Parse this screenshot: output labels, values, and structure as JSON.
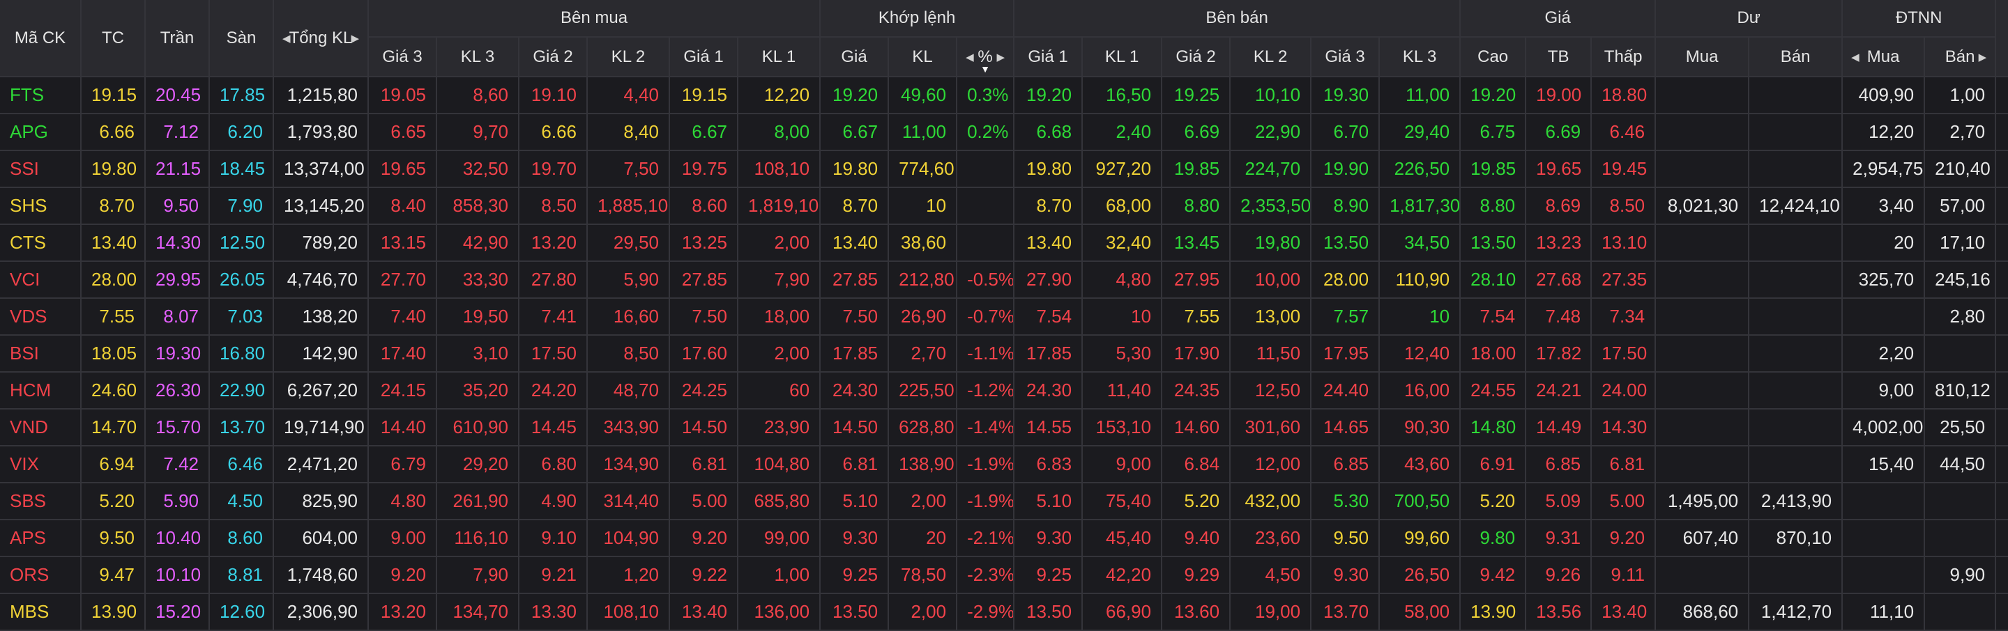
{
  "colors": {
    "up": "#2ed937",
    "down": "#f2424a",
    "ref": "#f0d236",
    "ceil": "#e45fff",
    "floor": "#38d4e8",
    "neutral": "#e8e8e8"
  },
  "icons": {
    "sort_left": "caret-left-icon",
    "sort_right": "caret-right-icon",
    "sort_down": "caret-down-icon"
  },
  "header": {
    "ma_ck": "Mã CK",
    "tc": "TC",
    "tran": "Trần",
    "san": "Sàn",
    "tong_kl": "Tổng KL",
    "ben_mua": "Bên mua",
    "khop_lenh": "Khớp lệnh",
    "ben_ban": "Bên bán",
    "gia": "Giá",
    "du": "Dư",
    "dtnn": "ĐTNN",
    "sub": {
      "gia3": "Giá 3",
      "kl3": "KL 3",
      "gia2": "Giá 2",
      "kl2": "KL 2",
      "gia1": "Giá 1",
      "kl1": "KL 1",
      "khop_gia": "Giá",
      "khop_kl": "KL",
      "pct": "%",
      "ban_gia1": "Giá 1",
      "ban_kl1": "KL 1",
      "ban_gia2": "Giá 2",
      "ban_kl2": "KL 2",
      "ban_gia3": "Giá 3",
      "ban_kl3": "KL 3",
      "cao": "Cao",
      "tb": "TB",
      "thap": "Thấp",
      "du_mua": "Mua",
      "du_ban": "Bán",
      "nn_mua": "Mua",
      "nn_ban": "Bán"
    }
  },
  "rows": [
    [
      "FTS",
      "19.15",
      "20.45",
      "17.85",
      "1,215,80",
      "19.05",
      "8,60",
      "19.10",
      "4,40",
      "19.15",
      "12,20",
      "19.20",
      "49,60",
      "0.3%",
      "19.20",
      "16,50",
      "19.25",
      "10,10",
      "19.30",
      "11,00",
      "19.20",
      "19.00",
      "18.80",
      "",
      "",
      "409,90",
      "1,00"
    ],
    [
      "APG",
      "6.66",
      "7.12",
      "6.20",
      "1,793,80",
      "6.65",
      "9,70",
      "6.66",
      "8,40",
      "6.67",
      "8,00",
      "6.67",
      "11,00",
      "0.2%",
      "6.68",
      "2,40",
      "6.69",
      "22,90",
      "6.70",
      "29,40",
      "6.75",
      "6.69",
      "6.46",
      "",
      "",
      "12,20",
      "2,70"
    ],
    [
      "SSI",
      "19.80",
      "21.15",
      "18.45",
      "13,374,00",
      "19.65",
      "32,50",
      "19.70",
      "7,50",
      "19.75",
      "108,10",
      "19.80",
      "774,60",
      "",
      "19.80",
      "927,20",
      "19.85",
      "224,70",
      "19.90",
      "226,50",
      "19.85",
      "19.65",
      "19.45",
      "",
      "",
      "2,954,75",
      "210,40"
    ],
    [
      "SHS",
      "8.70",
      "9.50",
      "7.90",
      "13,145,20",
      "8.40",
      "858,30",
      "8.50",
      "1,885,10",
      "8.60",
      "1,819,10",
      "8.70",
      "10",
      "",
      "8.70",
      "68,00",
      "8.80",
      "2,353,50",
      "8.90",
      "1,817,30",
      "8.80",
      "8.69",
      "8.50",
      "8,021,30",
      "12,424,10",
      "3,40",
      "57,00"
    ],
    [
      "CTS",
      "13.40",
      "14.30",
      "12.50",
      "789,20",
      "13.15",
      "42,90",
      "13.20",
      "29,50",
      "13.25",
      "2,00",
      "13.40",
      "38,60",
      "",
      "13.40",
      "32,40",
      "13.45",
      "19,80",
      "13.50",
      "34,50",
      "13.50",
      "13.23",
      "13.10",
      "",
      "",
      "20",
      "17,10"
    ],
    [
      "VCI",
      "28.00",
      "29.95",
      "26.05",
      "4,746,70",
      "27.70",
      "33,30",
      "27.80",
      "5,90",
      "27.85",
      "7,90",
      "27.85",
      "212,80",
      "-0.5%",
      "27.90",
      "4,80",
      "27.95",
      "10,00",
      "28.00",
      "110,90",
      "28.10",
      "27.68",
      "27.35",
      "",
      "",
      "325,70",
      "245,16"
    ],
    [
      "VDS",
      "7.55",
      "8.07",
      "7.03",
      "138,20",
      "7.40",
      "19,50",
      "7.41",
      "16,60",
      "7.50",
      "18,00",
      "7.50",
      "26,90",
      "-0.7%",
      "7.54",
      "10",
      "7.55",
      "13,00",
      "7.57",
      "10",
      "7.54",
      "7.48",
      "7.34",
      "",
      "",
      "",
      "2,80"
    ],
    [
      "BSI",
      "18.05",
      "19.30",
      "16.80",
      "142,90",
      "17.40",
      "3,10",
      "17.50",
      "8,50",
      "17.60",
      "2,00",
      "17.85",
      "2,70",
      "-1.1%",
      "17.85",
      "5,30",
      "17.90",
      "11,50",
      "17.95",
      "12,40",
      "18.00",
      "17.82",
      "17.50",
      "",
      "",
      "2,20",
      ""
    ],
    [
      "HCM",
      "24.60",
      "26.30",
      "22.90",
      "6,267,20",
      "24.15",
      "35,20",
      "24.20",
      "48,70",
      "24.25",
      "60",
      "24.30",
      "225,50",
      "-1.2%",
      "24.30",
      "11,40",
      "24.35",
      "12,50",
      "24.40",
      "16,00",
      "24.55",
      "24.21",
      "24.00",
      "",
      "",
      "9,00",
      "810,12"
    ],
    [
      "VND",
      "14.70",
      "15.70",
      "13.70",
      "19,714,90",
      "14.40",
      "610,90",
      "14.45",
      "343,90",
      "14.50",
      "23,90",
      "14.50",
      "628,80",
      "-1.4%",
      "14.55",
      "153,10",
      "14.60",
      "301,60",
      "14.65",
      "90,30",
      "14.80",
      "14.49",
      "14.30",
      "",
      "",
      "4,002,00",
      "25,50"
    ],
    [
      "VIX",
      "6.94",
      "7.42",
      "6.46",
      "2,471,20",
      "6.79",
      "29,20",
      "6.80",
      "134,90",
      "6.81",
      "104,80",
      "6.81",
      "138,90",
      "-1.9%",
      "6.83",
      "9,00",
      "6.84",
      "12,00",
      "6.85",
      "43,60",
      "6.91",
      "6.85",
      "6.81",
      "",
      "",
      "15,40",
      "44,50"
    ],
    [
      "SBS",
      "5.20",
      "5.90",
      "4.50",
      "825,90",
      "4.80",
      "261,90",
      "4.90",
      "314,40",
      "5.00",
      "685,80",
      "5.10",
      "2,00",
      "-1.9%",
      "5.10",
      "75,40",
      "5.20",
      "432,00",
      "5.30",
      "700,50",
      "5.20",
      "5.09",
      "5.00",
      "1,495,00",
      "2,413,90",
      "",
      ""
    ],
    [
      "APS",
      "9.50",
      "10.40",
      "8.60",
      "604,00",
      "9.00",
      "116,10",
      "9.10",
      "104,90",
      "9.20",
      "99,00",
      "9.30",
      "20",
      "-2.1%",
      "9.30",
      "45,40",
      "9.40",
      "23,60",
      "9.50",
      "99,60",
      "9.80",
      "9.31",
      "9.20",
      "607,40",
      "870,10",
      "",
      ""
    ],
    [
      "ORS",
      "9.47",
      "10.10",
      "8.81",
      "1,748,60",
      "9.20",
      "7,90",
      "9.21",
      "1,20",
      "9.22",
      "1,00",
      "9.25",
      "78,50",
      "-2.3%",
      "9.25",
      "42,20",
      "9.29",
      "4,50",
      "9.30",
      "26,50",
      "9.42",
      "9.26",
      "9.11",
      "",
      "",
      "",
      "9,90"
    ],
    [
      "MBS",
      "13.90",
      "15.20",
      "12.60",
      "2,306,90",
      "13.20",
      "134,70",
      "13.30",
      "108,10",
      "13.40",
      "136,00",
      "13.50",
      "2,00",
      "-2.9%",
      "13.50",
      "66,90",
      "13.60",
      "19,00",
      "13.70",
      "58,00",
      "13.90",
      "13.56",
      "13.40",
      "868,60",
      "1,412,70",
      "11,10",
      ""
    ]
  ],
  "row_colors": [
    [
      "up",
      "ref",
      "ceil",
      "floor",
      "neutral",
      "down",
      "down",
      "down",
      "down",
      "ref",
      "ref",
      "up",
      "up",
      "up",
      "up",
      "up",
      "up",
      "up",
      "up",
      "up",
      "up",
      "down",
      "down",
      "neutral",
      "neutral",
      "neutral",
      "neutral"
    ],
    [
      "up",
      "ref",
      "ceil",
      "floor",
      "neutral",
      "down",
      "down",
      "ref",
      "ref",
      "up",
      "up",
      "up",
      "up",
      "up",
      "up",
      "up",
      "up",
      "up",
      "up",
      "up",
      "up",
      "up",
      "down",
      "neutral",
      "neutral",
      "neutral",
      "neutral"
    ],
    [
      "down",
      "ref",
      "ceil",
      "floor",
      "neutral",
      "down",
      "down",
      "down",
      "down",
      "down",
      "down",
      "ref",
      "ref",
      "neutral",
      "ref",
      "ref",
      "up",
      "up",
      "up",
      "up",
      "up",
      "down",
      "down",
      "neutral",
      "neutral",
      "neutral",
      "neutral"
    ],
    [
      "ref",
      "ref",
      "ceil",
      "floor",
      "neutral",
      "down",
      "down",
      "down",
      "down",
      "down",
      "down",
      "ref",
      "ref",
      "neutral",
      "ref",
      "ref",
      "up",
      "up",
      "up",
      "up",
      "up",
      "down",
      "down",
      "neutral",
      "neutral",
      "neutral",
      "neutral"
    ],
    [
      "ref",
      "ref",
      "ceil",
      "floor",
      "neutral",
      "down",
      "down",
      "down",
      "down",
      "down",
      "down",
      "ref",
      "ref",
      "neutral",
      "ref",
      "ref",
      "up",
      "up",
      "up",
      "up",
      "up",
      "down",
      "down",
      "neutral",
      "neutral",
      "neutral",
      "neutral"
    ],
    [
      "down",
      "ref",
      "ceil",
      "floor",
      "neutral",
      "down",
      "down",
      "down",
      "down",
      "down",
      "down",
      "down",
      "down",
      "down",
      "down",
      "down",
      "down",
      "down",
      "ref",
      "ref",
      "up",
      "down",
      "down",
      "neutral",
      "neutral",
      "neutral",
      "neutral"
    ],
    [
      "down",
      "ref",
      "ceil",
      "floor",
      "neutral",
      "down",
      "down",
      "down",
      "down",
      "down",
      "down",
      "down",
      "down",
      "down",
      "down",
      "down",
      "ref",
      "ref",
      "up",
      "up",
      "down",
      "down",
      "down",
      "neutral",
      "neutral",
      "neutral",
      "neutral"
    ],
    [
      "down",
      "ref",
      "ceil",
      "floor",
      "neutral",
      "down",
      "down",
      "down",
      "down",
      "down",
      "down",
      "down",
      "down",
      "down",
      "down",
      "down",
      "down",
      "down",
      "down",
      "down",
      "down",
      "down",
      "down",
      "neutral",
      "neutral",
      "neutral",
      "neutral"
    ],
    [
      "down",
      "ref",
      "ceil",
      "floor",
      "neutral",
      "down",
      "down",
      "down",
      "down",
      "down",
      "down",
      "down",
      "down",
      "down",
      "down",
      "down",
      "down",
      "down",
      "down",
      "down",
      "down",
      "down",
      "down",
      "neutral",
      "neutral",
      "neutral",
      "neutral"
    ],
    [
      "down",
      "ref",
      "ceil",
      "floor",
      "neutral",
      "down",
      "down",
      "down",
      "down",
      "down",
      "down",
      "down",
      "down",
      "down",
      "down",
      "down",
      "down",
      "down",
      "down",
      "down",
      "up",
      "down",
      "down",
      "neutral",
      "neutral",
      "neutral",
      "neutral"
    ],
    [
      "down",
      "ref",
      "ceil",
      "floor",
      "neutral",
      "down",
      "down",
      "down",
      "down",
      "down",
      "down",
      "down",
      "down",
      "down",
      "down",
      "down",
      "down",
      "down",
      "down",
      "down",
      "down",
      "down",
      "down",
      "neutral",
      "neutral",
      "neutral",
      "neutral"
    ],
    [
      "down",
      "ref",
      "ceil",
      "floor",
      "neutral",
      "down",
      "down",
      "down",
      "down",
      "down",
      "down",
      "down",
      "down",
      "down",
      "down",
      "down",
      "ref",
      "ref",
      "up",
      "up",
      "ref",
      "down",
      "down",
      "neutral",
      "neutral",
      "neutral",
      "neutral"
    ],
    [
      "down",
      "ref",
      "ceil",
      "floor",
      "neutral",
      "down",
      "down",
      "down",
      "down",
      "down",
      "down",
      "down",
      "down",
      "down",
      "down",
      "down",
      "down",
      "down",
      "ref",
      "ref",
      "up",
      "down",
      "down",
      "neutral",
      "neutral",
      "neutral",
      "neutral"
    ],
    [
      "down",
      "ref",
      "ceil",
      "floor",
      "neutral",
      "down",
      "down",
      "down",
      "down",
      "down",
      "down",
      "down",
      "down",
      "down",
      "down",
      "down",
      "down",
      "down",
      "down",
      "down",
      "down",
      "down",
      "down",
      "neutral",
      "neutral",
      "neutral",
      "neutral"
    ],
    [
      "ref",
      "ref",
      "ceil",
      "floor",
      "neutral",
      "down",
      "down",
      "down",
      "down",
      "down",
      "down",
      "down",
      "down",
      "down",
      "down",
      "down",
      "down",
      "down",
      "down",
      "down",
      "ref",
      "down",
      "down",
      "neutral",
      "neutral",
      "neutral",
      "neutral"
    ]
  ]
}
